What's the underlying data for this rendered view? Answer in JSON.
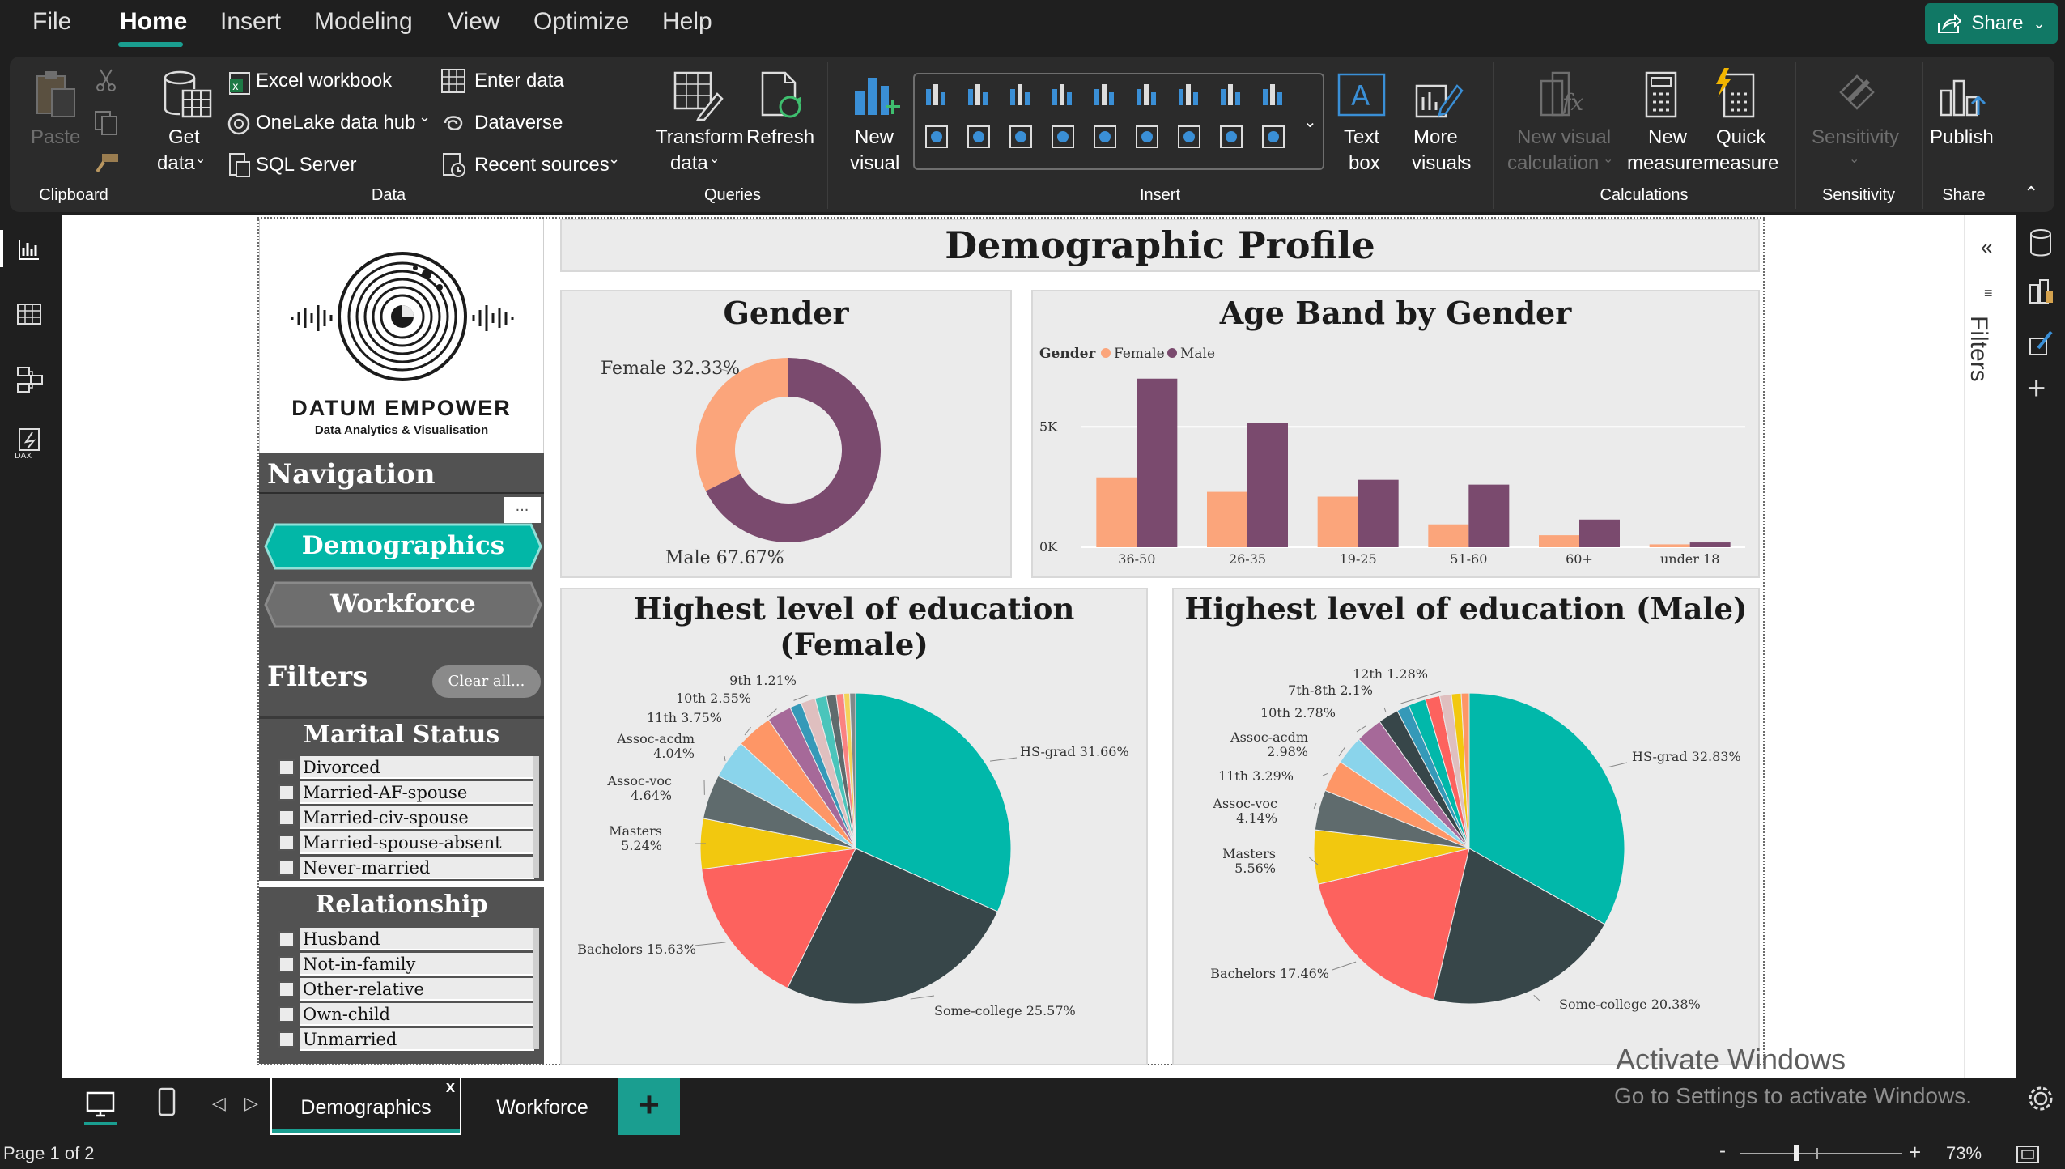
{
  "menu": {
    "items": [
      "File",
      "Home",
      "Insert",
      "Modeling",
      "View",
      "Optimize",
      "Help"
    ],
    "active": "Home",
    "share_label": "Share"
  },
  "ribbon": {
    "clipboard": {
      "paste": "Paste",
      "group": "Clipboard"
    },
    "data": {
      "get_data": "Get",
      "get_data2": "data",
      "excel": "Excel workbook",
      "onelake": "OneLake data hub",
      "sql": "SQL Server",
      "enter_data": "Enter data",
      "dataverse": "Dataverse",
      "recent": "Recent sources",
      "group": "Data"
    },
    "queries": {
      "transform": "Transform",
      "transform2": "data",
      "refresh": "Refresh",
      "group": "Queries"
    },
    "insert": {
      "new_visual": "New",
      "new_visual2": "visual",
      "text_box": "Text",
      "text_box2": "box",
      "more_visuals": "More",
      "more_visuals2": "visuals",
      "group": "Insert"
    },
    "calculations": {
      "new_visual_calc": "New visual",
      "new_visual_calc2": "calculation",
      "new_measure": "New",
      "new_measure2": "measure",
      "quick_measure": "Quick",
      "quick_measure2": "measure",
      "group": "Calculations"
    },
    "sensitivity": {
      "label": "Sensitivity",
      "group": "Sensitivity"
    },
    "share": {
      "publish": "Publish",
      "group": "Share"
    }
  },
  "report": {
    "title": "Demographic Profile",
    "logo_name": "DATUM EMPOWER",
    "logo_tagline": "Data Analytics & Visualisation",
    "navigation_title": "Navigation",
    "nav_buttons": [
      "Demographics",
      "Workforce"
    ],
    "filters_title": "Filters",
    "clear_all": "Clear all...",
    "more_options": "...",
    "marital_status": {
      "title": "Marital Status",
      "items": [
        "Divorced",
        "Married-AF-spouse",
        "Married-civ-spouse",
        "Married-spouse-absent",
        "Never-married"
      ]
    },
    "relationship": {
      "title": "Relationship",
      "items": [
        "Husband",
        "Not-in-family",
        "Other-relative",
        "Own-child",
        "Unmarried"
      ]
    }
  },
  "chart_data": [
    {
      "type": "pie",
      "title": "Gender",
      "donut": true,
      "categories": [
        "Female",
        "Male"
      ],
      "values": [
        32.33,
        67.67
      ],
      "labels": [
        "Female 32.33%",
        "Male 67.67%"
      ],
      "colors": [
        "#fba57b",
        "#7a4a6e"
      ]
    },
    {
      "type": "bar",
      "title": "Age Band by Gender",
      "legend_title": "Gender",
      "legend_position": "top-left",
      "categories": [
        "36-50",
        "26-35",
        "19-25",
        "51-60",
        "60+",
        "under 18"
      ],
      "series": [
        {
          "name": "Female",
          "color": "#fba57b",
          "values": [
            2900,
            2300,
            2100,
            950,
            500,
            120
          ]
        },
        {
          "name": "Male",
          "color": "#7a4a6e",
          "values": [
            7000,
            5150,
            2800,
            2600,
            1150,
            200
          ]
        }
      ],
      "yticks": [
        "0K",
        "5K"
      ],
      "ylim": [
        0,
        8000
      ],
      "grid": true
    },
    {
      "type": "pie",
      "title": "Highest level of education (Female)",
      "slices": [
        {
          "name": "HS-grad",
          "value": 31.66,
          "color": "#01b8aa",
          "label": "HS-grad 31.66%"
        },
        {
          "name": "Some-college",
          "value": 25.57,
          "color": "#374649",
          "label": "Some-college 25.57%"
        },
        {
          "name": "Bachelors",
          "value": 15.63,
          "color": "#fd625e",
          "label": "Bachelors 15.63%"
        },
        {
          "name": "Masters",
          "value": 5.24,
          "color": "#f2c80f",
          "label": "Masters 5.24%"
        },
        {
          "name": "Assoc-voc",
          "value": 4.64,
          "color": "#5f6b6d",
          "label": "Assoc-voc 4.64%"
        },
        {
          "name": "Assoc-acdm",
          "value": 4.04,
          "color": "#8ad4eb",
          "label": "Assoc-acdm 4.04%"
        },
        {
          "name": "11th",
          "value": 3.75,
          "color": "#fe9666",
          "label": "11th 3.75%"
        },
        {
          "name": "10th",
          "value": 2.55,
          "color": "#a66999",
          "label": "10th 2.55%"
        },
        {
          "name": "9th",
          "value": 1.21,
          "color": "#3599b8",
          "label": "9th 1.21%"
        },
        {
          "name": "s10",
          "value": 1.5,
          "color": "#dfbfbf",
          "label": ""
        },
        {
          "name": "s11",
          "value": 1.2,
          "color": "#4ac5bb",
          "label": ""
        },
        {
          "name": "s12",
          "value": 1.0,
          "color": "#5f6b6d",
          "label": ""
        },
        {
          "name": "s13",
          "value": 0.8,
          "color": "#fb8281",
          "label": ""
        },
        {
          "name": "s14",
          "value": 0.6,
          "color": "#f4d25a",
          "label": ""
        },
        {
          "name": "s15",
          "value": 0.61,
          "color": "#7f898a",
          "label": ""
        }
      ]
    },
    {
      "type": "pie",
      "title": "Highest level of education (Male)",
      "slices": [
        {
          "name": "HS-grad",
          "value": 32.83,
          "color": "#01b8aa",
          "label": "HS-grad 32.83%"
        },
        {
          "name": "Some-college",
          "value": 20.38,
          "color": "#374649",
          "label": "Some-college 20.38%"
        },
        {
          "name": "Bachelors",
          "value": 17.46,
          "color": "#fd625e",
          "label": "Bachelors 17.46%"
        },
        {
          "name": "Masters",
          "value": 5.56,
          "color": "#f2c80f",
          "label": "Masters 5.56%"
        },
        {
          "name": "Assoc-voc",
          "value": 4.14,
          "color": "#5f6b6d",
          "label": "Assoc-voc 4.14%"
        },
        {
          "name": "11th",
          "value": 3.29,
          "color": "#fe9666",
          "label": "11th 3.29%"
        },
        {
          "name": "Assoc-acdm",
          "value": 2.98,
          "color": "#8ad4eb",
          "label": "Assoc-acdm 2.98%"
        },
        {
          "name": "10th",
          "value": 2.78,
          "color": "#a66999",
          "label": "10th 2.78%"
        },
        {
          "name": "7th-8th",
          "value": 2.1,
          "color": "#374649",
          "label": "7th-8th 2.1%"
        },
        {
          "name": "12th",
          "value": 1.28,
          "color": "#3599b8",
          "label": "12th 1.28%"
        },
        {
          "name": "s11",
          "value": 1.8,
          "color": "#01b8aa",
          "label": ""
        },
        {
          "name": "s12",
          "value": 1.5,
          "color": "#fd625e",
          "label": ""
        },
        {
          "name": "s13",
          "value": 1.2,
          "color": "#dfbfbf",
          "label": ""
        },
        {
          "name": "s14",
          "value": 1.0,
          "color": "#f2c80f",
          "label": ""
        },
        {
          "name": "s15",
          "value": 0.82,
          "color": "#fe9666",
          "label": ""
        }
      ]
    }
  ],
  "tabs": {
    "pages": [
      "Demographics",
      "Workforce"
    ],
    "active": "Demographics",
    "close": "x",
    "add": "+"
  },
  "watermark": {
    "line1": "Activate Windows",
    "line2": "Go to Settings to activate Windows."
  },
  "right_pane": {
    "filters_label": "Filters"
  },
  "status": {
    "page": "Page 1 of 2",
    "zoom": "73%",
    "minus": "-",
    "plus": "+"
  }
}
